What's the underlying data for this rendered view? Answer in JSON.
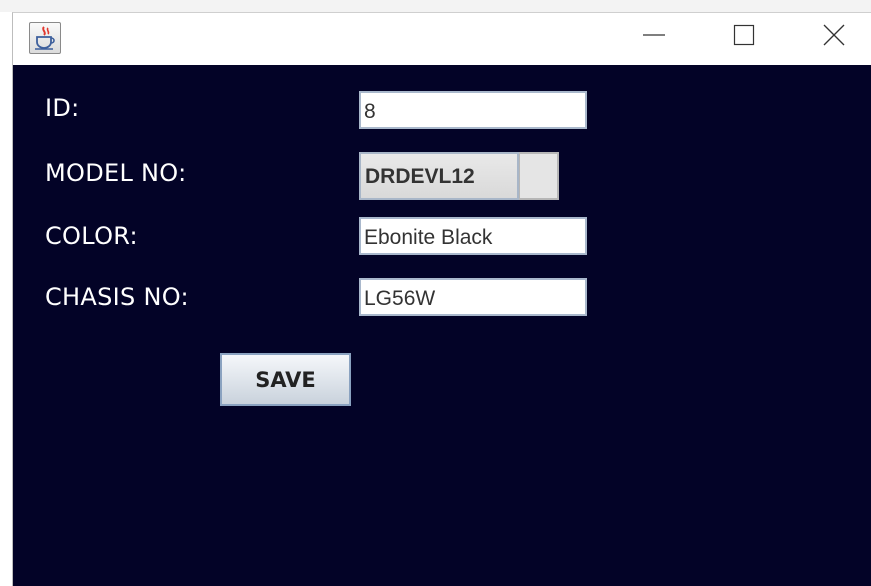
{
  "window": {
    "icon": "java-coffee-cup-icon",
    "controls": {
      "minimize_icon": "minimize-icon",
      "maximize_icon": "maximize-icon",
      "close_icon": "close-icon"
    }
  },
  "form": {
    "background_color": "#030327",
    "id_label": "ID:",
    "id_value": "8",
    "model_label": "MODEL NO:",
    "model_value": "DRDEVL12",
    "color_label": "COLOR:",
    "color_value": "Ebonite Black",
    "chasis_label": "CHASIS NO:",
    "chasis_value": "LG56W",
    "save_label": "SAVE"
  }
}
